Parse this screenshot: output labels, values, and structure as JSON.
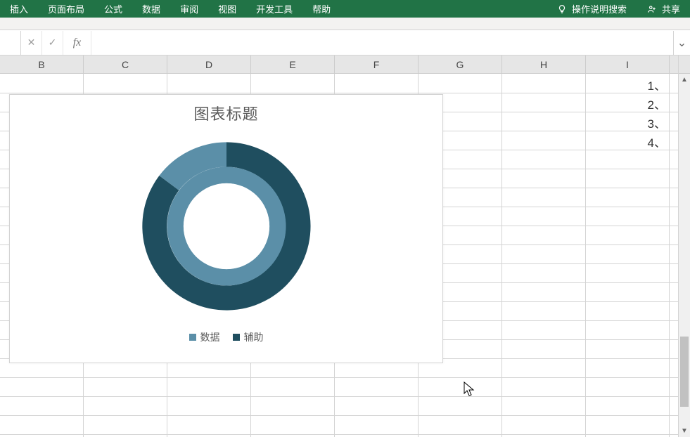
{
  "ribbon": {
    "tabs": [
      "插入",
      "页面布局",
      "公式",
      "数据",
      "审阅",
      "视图",
      "开发工具",
      "帮助"
    ],
    "tell_me": "操作说明搜索",
    "share": "共享"
  },
  "formula_bar": {
    "cancel_glyph": "✕",
    "enter_glyph": "✓",
    "fx_label": "fx",
    "value": "",
    "dropdown_glyph": "⌄"
  },
  "columns": [
    "B",
    "C",
    "D",
    "E",
    "F",
    "G",
    "H",
    "I"
  ],
  "row_labels": [
    "1、",
    "2、",
    "3、",
    "4、"
  ],
  "chart": {
    "title": "图表标题",
    "legend": {
      "series1": "数据",
      "series2": "辅助"
    }
  },
  "chart_data": {
    "type": "pie",
    "subtype": "doughnut",
    "title": "图表标题",
    "series": [
      {
        "name": "数据",
        "values": [
          100
        ],
        "color": "#5B8FA8"
      },
      {
        "name": "辅助",
        "values": [
          15,
          85
        ],
        "color": "#1F4E5F",
        "segment_colors": [
          "#5B8FA8",
          "#1F4E5F"
        ]
      }
    ],
    "hole_size": 0.55,
    "start_angle": 0,
    "legend_position": "bottom"
  },
  "colors": {
    "ribbon_bg": "#217346",
    "inner_ring": "#5B8FA8",
    "inner_ring_cut": "#5B8FA8",
    "outer_ring": "#1F4E5F"
  },
  "scrollbar": {
    "up_glyph": "▲",
    "down_glyph": "▼"
  }
}
